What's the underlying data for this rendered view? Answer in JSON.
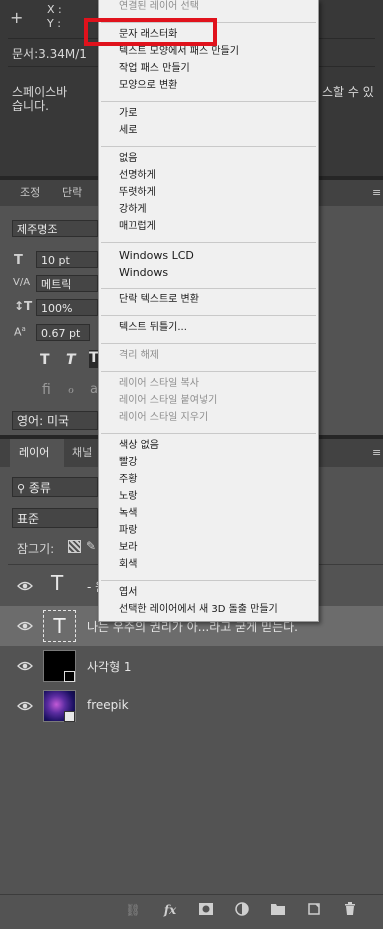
{
  "info": {
    "x_label": "X :",
    "y_label": "Y :",
    "doc_size": "문서:3.34M/1",
    "text_preview_line1": "스페이스바",
    "text_preview_line1_right": "스할 수 있",
    "text_preview_line2": "습니다."
  },
  "char_panel": {
    "tabs": [
      "조정",
      "단락"
    ],
    "font_family": "제주명조",
    "font_size": "10 pt",
    "kerning": "메트릭",
    "vertical_scale": "100%",
    "baseline_shift": "0.67 pt",
    "language": "영어: 미국"
  },
  "layers_panel": {
    "tabs": [
      "레이어",
      "채널"
    ],
    "filter": "종류",
    "blend_mode": "표준",
    "lock_label": "잠그기:",
    "layers": [
      {
        "name": "- 원",
        "type": "text"
      },
      {
        "name": "나는 우주의 권리가 아...라고 굳게 믿는다.",
        "type": "text"
      },
      {
        "name": "사각형 1",
        "type": "shape"
      },
      {
        "name": "freepik",
        "type": "image"
      }
    ]
  },
  "context_menu": {
    "items": [
      {
        "label": "연결된 레이어 선택",
        "disabled": true
      },
      {
        "label": "문자 래스터화",
        "disabled": false
      },
      {
        "label": "텍스트 모양에서 패스 만들기",
        "disabled": false
      },
      {
        "label": "작업 패스 만들기",
        "disabled": false
      },
      {
        "label": "모양으로 변환",
        "disabled": false
      },
      {
        "label": "가로",
        "disabled": false
      },
      {
        "label": "세로",
        "disabled": false
      },
      {
        "label": "없음",
        "disabled": false
      },
      {
        "label": "선명하게",
        "disabled": false
      },
      {
        "label": "뚜렷하게",
        "disabled": false
      },
      {
        "label": "강하게",
        "disabled": false
      },
      {
        "label": "매끄럽게",
        "disabled": false
      },
      {
        "label": "Windows LCD",
        "disabled": false
      },
      {
        "label": "Windows",
        "disabled": false
      },
      {
        "label": "단락 텍스트로 변환",
        "disabled": false
      },
      {
        "label": "텍스트 뒤틀기...",
        "disabled": false
      },
      {
        "label": "격리 해제",
        "disabled": true
      },
      {
        "label": "레이어 스타일 복사",
        "disabled": true
      },
      {
        "label": "레이어 스타일 붙여넣기",
        "disabled": true
      },
      {
        "label": "레이어 스타일 지우기",
        "disabled": true
      },
      {
        "label": "색상 없음",
        "disabled": false
      },
      {
        "label": "빨강",
        "disabled": false
      },
      {
        "label": "주황",
        "disabled": false
      },
      {
        "label": "노랑",
        "disabled": false
      },
      {
        "label": "녹색",
        "disabled": false
      },
      {
        "label": "파랑",
        "disabled": false
      },
      {
        "label": "보라",
        "disabled": false
      },
      {
        "label": "회색",
        "disabled": false
      },
      {
        "label": "엽서",
        "disabled": false
      },
      {
        "label": "선택한 레이어에서 새 3D 돌출 만들기",
        "disabled": false
      }
    ],
    "highlighted_item": "문자 래스터화",
    "highlight_color": "#e0121c"
  }
}
